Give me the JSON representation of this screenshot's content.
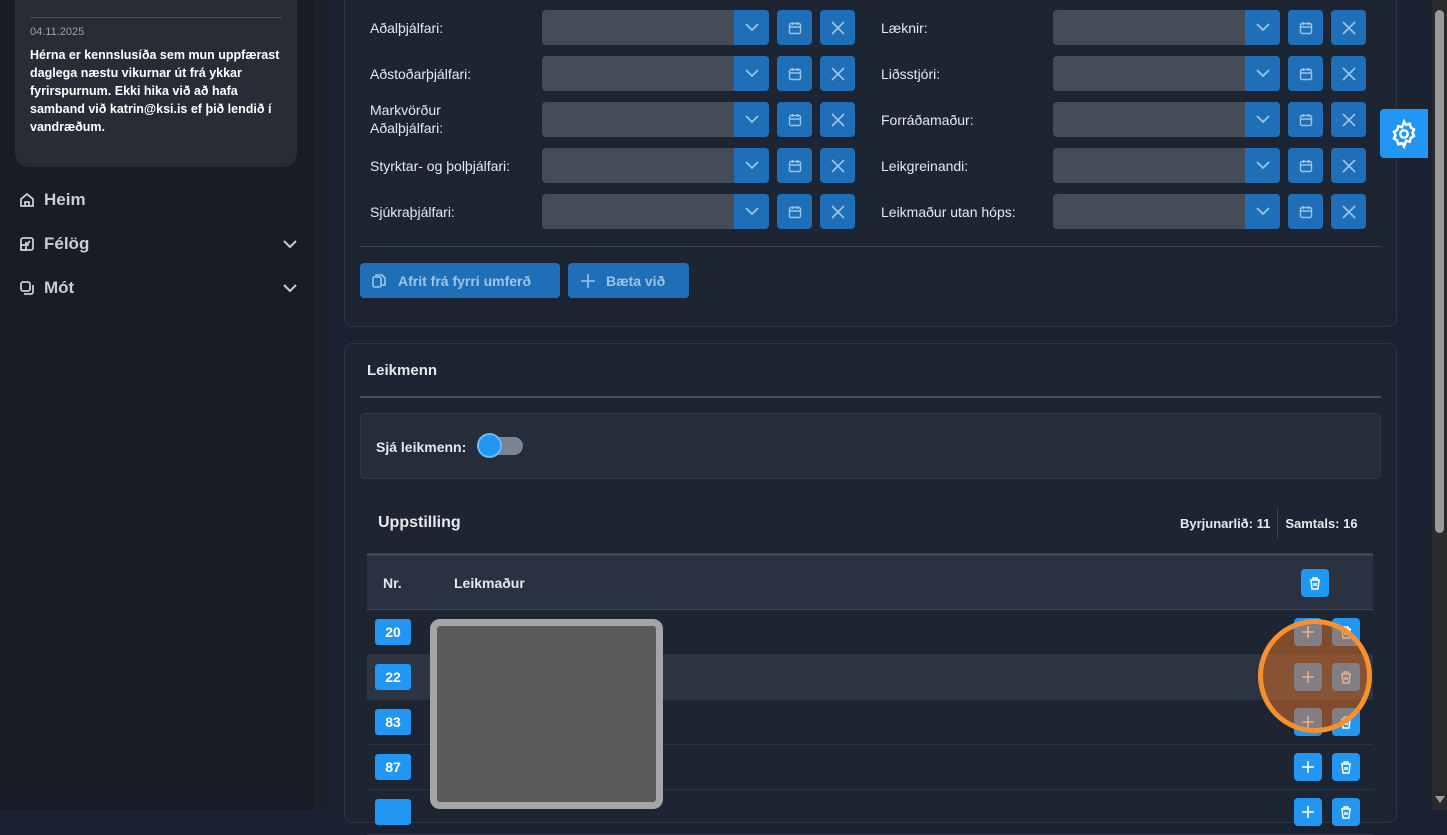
{
  "sidebar": {
    "note": {
      "date": "04.11.2025",
      "message": "Hérna er kennslusíða sem mun uppfærast daglega næstu vikurnar út frá ykkar fyrirspurnum. Ekki hika við að hafa samband við katrin@ksi.is ef þið lendið í vandræðum."
    },
    "nav": [
      {
        "label": "Heim",
        "icon": "home-icon"
      },
      {
        "label": "Félög",
        "icon": "clubs-icon"
      },
      {
        "label": "Mót",
        "icon": "tournaments-icon"
      }
    ]
  },
  "staff": {
    "left": [
      {
        "label": "Aðalþjálfari:",
        "value": ""
      },
      {
        "label": "Aðstoðarþjálfari:",
        "value": ""
      },
      {
        "label": "Markvörður Aðalþjálfari:",
        "value": ""
      },
      {
        "label": "Styrktar- og þolþjálfari:",
        "value": ""
      },
      {
        "label": "Sjúkraþjálfari:",
        "value": ""
      }
    ],
    "right": [
      {
        "label": "Læknir:",
        "value": ""
      },
      {
        "label": "Liðsstjóri:",
        "value": ""
      },
      {
        "label": "Forráðamaður:",
        "value": ""
      },
      {
        "label": "Leikgreinandi:",
        "value": ""
      },
      {
        "label": "Leikmaður utan hóps:",
        "value": ""
      }
    ],
    "copy_label": "Afrit frá fyrri umferð",
    "add_label": "Bæta við"
  },
  "players": {
    "title": "Leikmenn",
    "toggle_label": "Sjá leikmenn:",
    "toggle_on": false,
    "lineup_title": "Uppstilling",
    "starting_label": "Byrjunarlið: 11",
    "total_label": "Samtals: 16",
    "columns": [
      "Nr.",
      "Leikmaður"
    ],
    "rows": [
      {
        "number": "20"
      },
      {
        "number": "22"
      },
      {
        "number": "83"
      },
      {
        "number": "87"
      },
      {
        "number": ""
      }
    ]
  },
  "colors": {
    "accent": "#2196f3",
    "button": "#1f6fb8",
    "highlight": "#f7902f"
  }
}
